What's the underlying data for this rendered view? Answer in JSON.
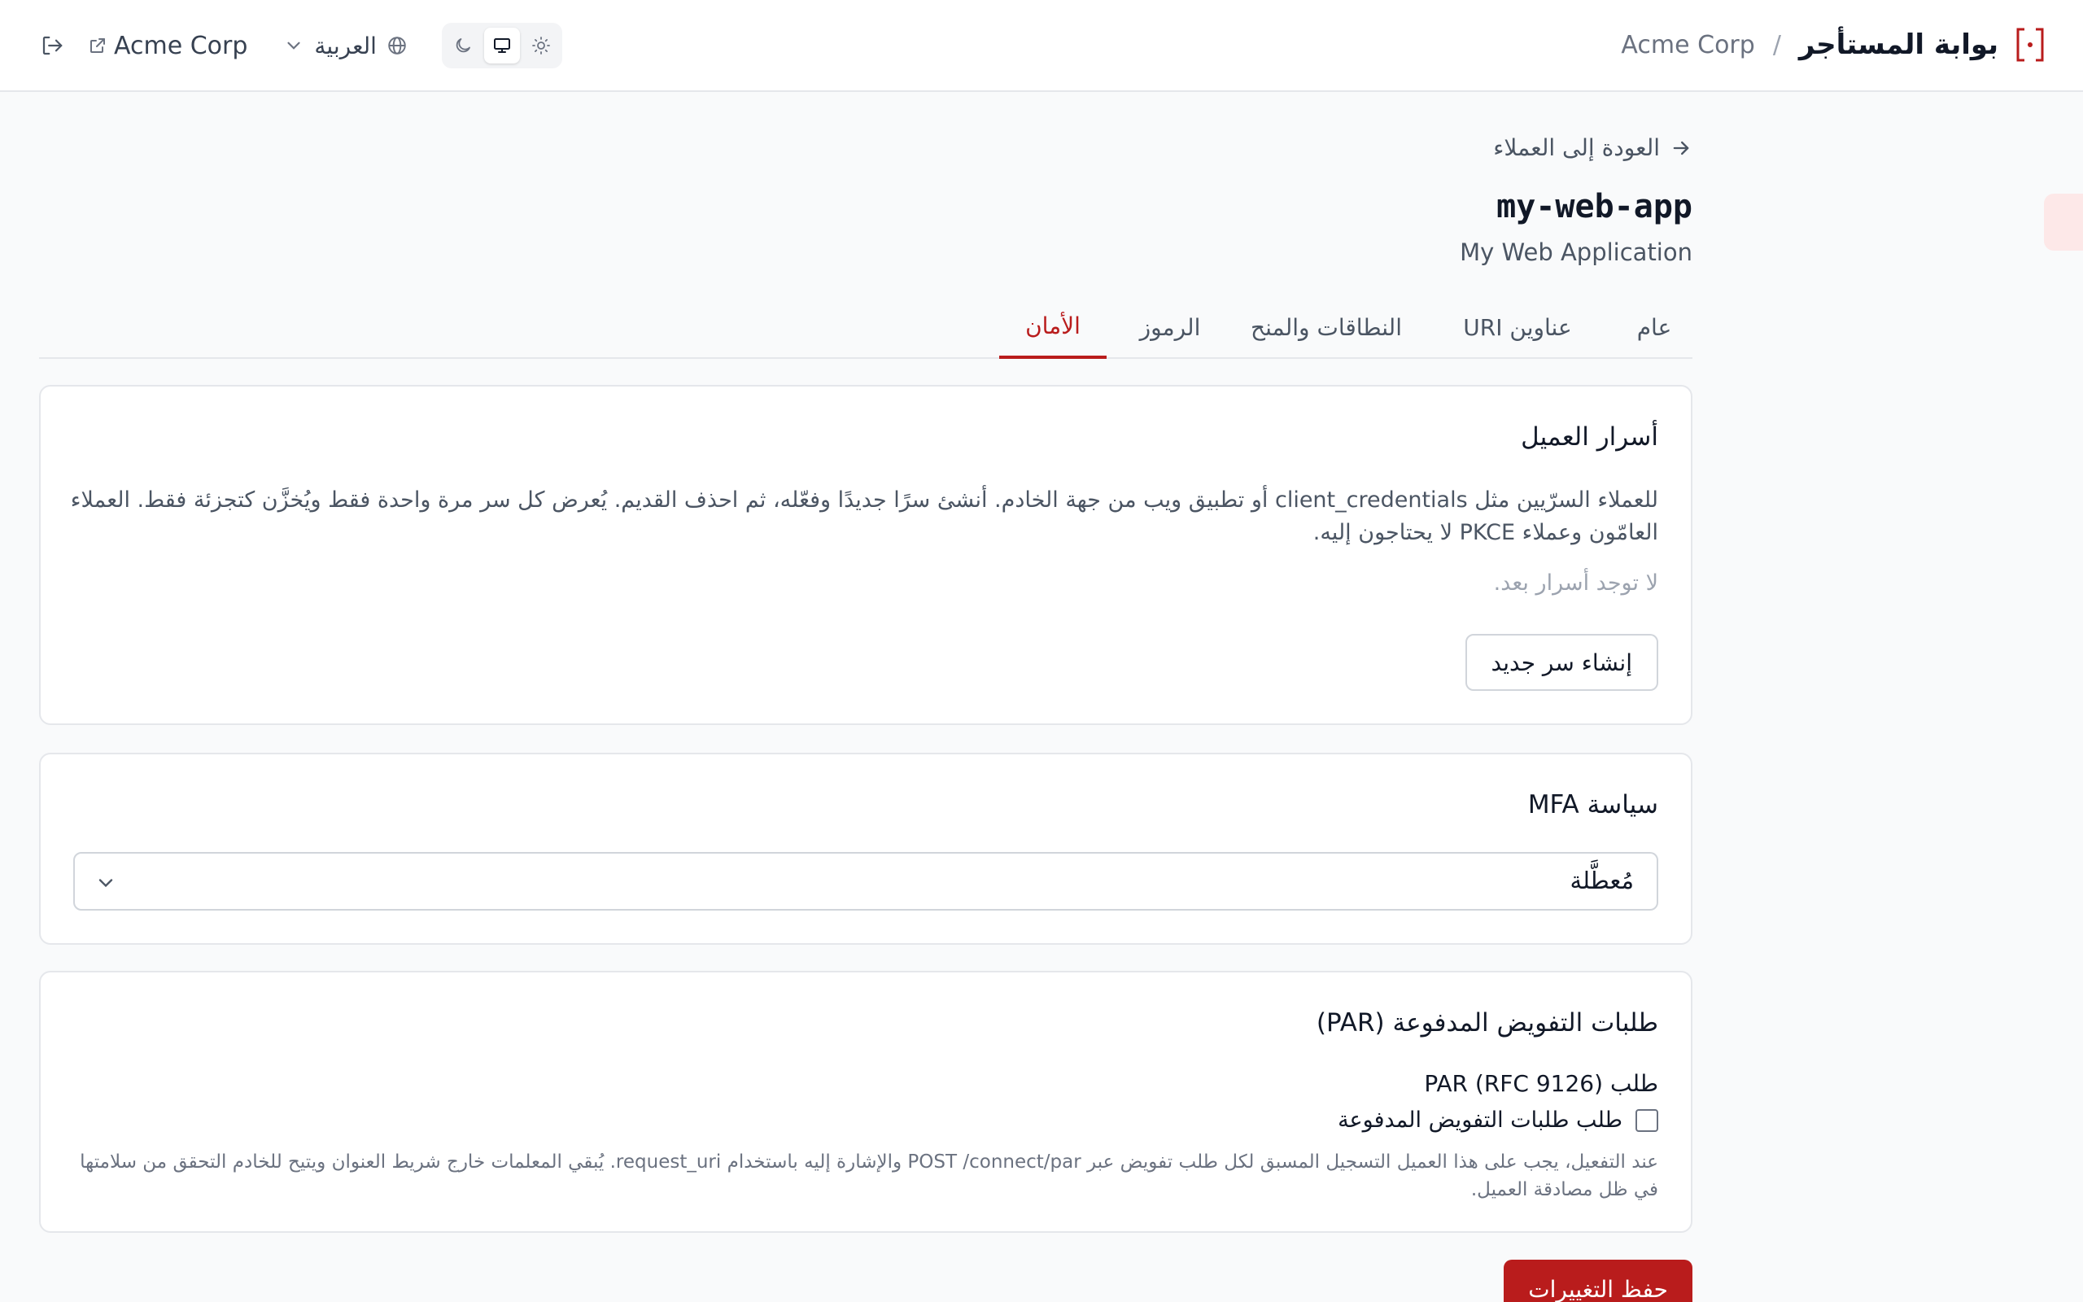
{
  "header": {
    "title": "بوابة المستأجر",
    "separator": "/",
    "tenant": "Acme Corp",
    "tenant_link": "Acme Corp",
    "language": "العربية"
  },
  "page": {
    "back_label": "العودة إلى العملاء",
    "client_id": "my-web-app",
    "client_name": "My Web Application"
  },
  "tabs": [
    {
      "label": "عام",
      "active": false
    },
    {
      "label": "عناوين URI",
      "active": false
    },
    {
      "label": "النطاقات والمنح",
      "active": false
    },
    {
      "label": "الرموز",
      "active": false
    },
    {
      "label": "الأمان",
      "active": true
    }
  ],
  "secrets": {
    "title": "أسرار العميل",
    "description": "للعملاء السرّيين مثل client_credentials أو تطبيق ويب من جهة الخادم. أنشئ سرًا جديدًا وفعّله، ثم احذف القديم. يُعرض كل سر مرة واحدة فقط ويُخزَّن كتجزئة فقط. العملاء العامّون وعملاء PKCE لا يحتاجون إليه.",
    "empty": "لا توجد أسرار بعد.",
    "create_button": "إنشاء سر جديد"
  },
  "mfa": {
    "title": "سياسة MFA",
    "selected": "مُعطَّلة"
  },
  "par": {
    "title": "طلبات التفويض المدفوعة (PAR)",
    "field_label": "طلب PAR (RFC 9126)",
    "checkbox_label": "طلب طلبات التفويض المدفوعة",
    "checked": false,
    "help": "عند التفعيل، يجب على هذا العميل التسجيل المسبق لكل طلب تفويض عبر POST /connect/par والإشارة إليه باستخدام request_uri. يُبقي المعلمات خارج شريط العنوان ويتيح للخادم التحقق من سلامتها في ظل مصادقة العميل."
  },
  "actions": {
    "save": "حفظ التغييرات"
  },
  "colors": {
    "accent": "#b91c1c",
    "border": "#e5e7eb"
  }
}
